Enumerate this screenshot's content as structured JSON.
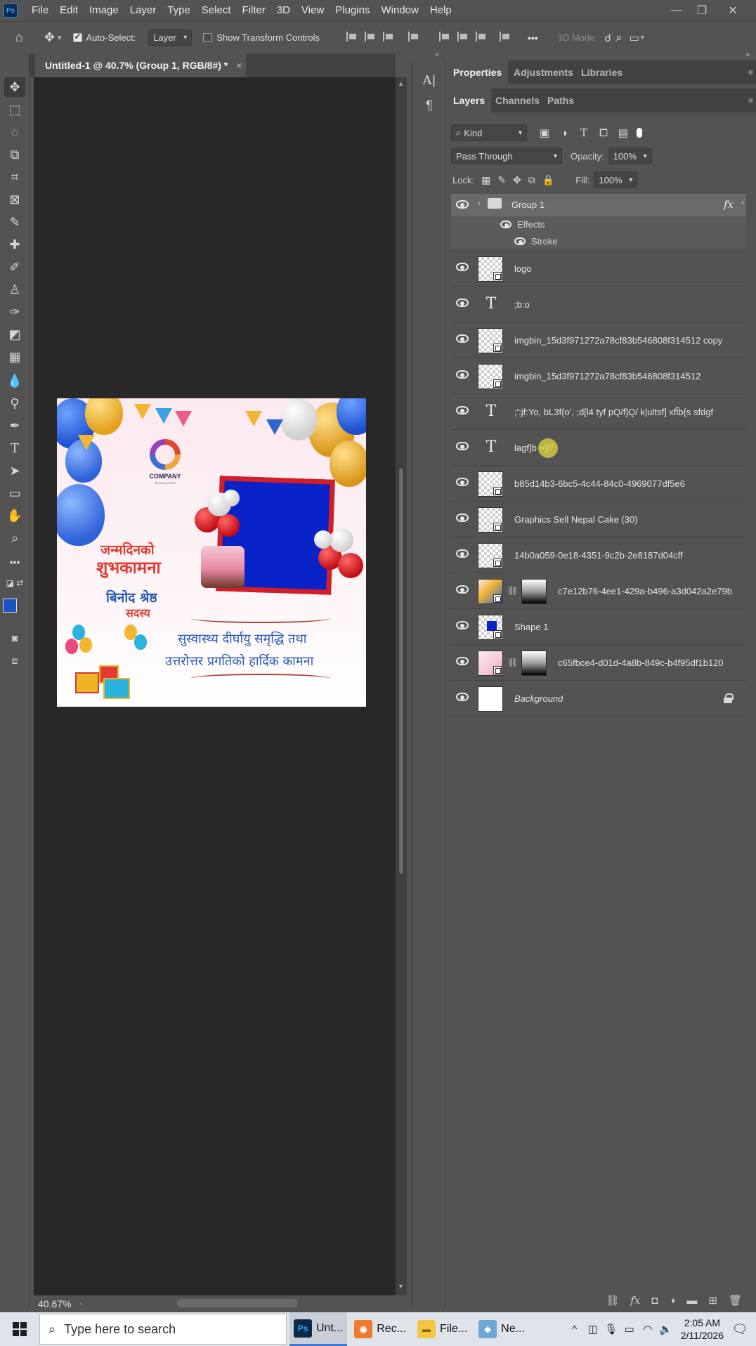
{
  "app": {
    "logo_text": "Ps",
    "menu": [
      "File",
      "Edit",
      "Image",
      "Layer",
      "Type",
      "Select",
      "Filter",
      "3D",
      "View",
      "Plugins",
      "Window",
      "Help"
    ]
  },
  "options_bar": {
    "auto_select_label": "Auto-Select:",
    "auto_select_checked": true,
    "auto_select_target": "Layer",
    "show_transform_label": "Show Transform Controls",
    "show_transform_checked": false,
    "more_label": "•••",
    "mode_3d_label": "3D Mode:"
  },
  "document": {
    "tab_title": "Untitled-1 @ 40.7% (Group 1, RGB/8#) *",
    "close_glyph": "×",
    "zoom": "40.67%",
    "artwork": {
      "company": "COMPANY",
      "company_slogan": "SLOGAN HERE",
      "headline1": "जन्मदिनको",
      "headline2": "शुभकामना",
      "name": "बिनोद श्रेष्ठ",
      "role": "सदस्य",
      "wish1": "सुस्वास्थ्य दीर्घायु समृद्धि तथा",
      "wish2": "उत्तरोत्तर प्रगतिको हार्दिक कामना",
      "colors": {
        "frame_blue": "#0a23c9",
        "frame_red": "#d31e26",
        "text_red": "#e23b31",
        "text_blue": "#2a5bb5"
      }
    }
  },
  "panels": {
    "top_tabs": [
      "Properties",
      "Adjustments",
      "Libraries"
    ],
    "layer_tabs": [
      "Layers",
      "Channels",
      "Paths"
    ],
    "filter_kind": "Kind",
    "blend_mode": "Pass Through",
    "opacity_label": "Opacity:",
    "opacity_value": "100%",
    "lock_label": "Lock:",
    "fill_label": "Fill:",
    "fill_value": "100%"
  },
  "layers": {
    "group": {
      "name": "Group 1",
      "fx": "fx",
      "effects_label": "Effects",
      "effect_item": "Stroke"
    },
    "rows": [
      {
        "name": "logo",
        "kind": "smart"
      },
      {
        "name": ";b:o",
        "kind": "text"
      },
      {
        "name": "imgbin_15d3f971272a78cf83b546808f314512 copy",
        "kind": "smart"
      },
      {
        "name": "imgbin_15d3f971272a78cf83b546808f314512",
        "kind": "smart"
      },
      {
        "name": ";':jf:Yo, bL3f{o', ;d[l4 tyf pQ/f]Q/ k|ultsf] xfl̃b{s sfdgf",
        "kind": "text"
      },
      {
        "name": "lagf]b >]i7",
        "kind": "text"
      },
      {
        "name": "b85d14b3-6bc5-4c44-84c0-4969077df5e6",
        "kind": "smart"
      },
      {
        "name": "Graphics Sell Nepal Cake (30)",
        "kind": "smart"
      },
      {
        "name": "14b0a059-0e18-4351-9c2b-2e8187d04cff",
        "kind": "smart"
      },
      {
        "name": "c7e12b76-4ee1-429a-b496-a3d042a2e79b",
        "kind": "masked"
      },
      {
        "name": "Shape 1",
        "kind": "shape"
      },
      {
        "name": "c65fbce4-d01d-4a8b-849c-b4f95df1b120",
        "kind": "masked"
      },
      {
        "name": "Background",
        "kind": "background"
      }
    ]
  },
  "taskbar": {
    "search_placeholder": "Type here to search",
    "apps": [
      {
        "label": "Unt...",
        "icon": "Ps"
      },
      {
        "label": "Rec...",
        "icon": "◉"
      },
      {
        "label": "File...",
        "icon": "▬"
      },
      {
        "label": "Ne...",
        "icon": "◆"
      }
    ],
    "time": "2:05 AM",
    "date": "2/11/2026"
  }
}
